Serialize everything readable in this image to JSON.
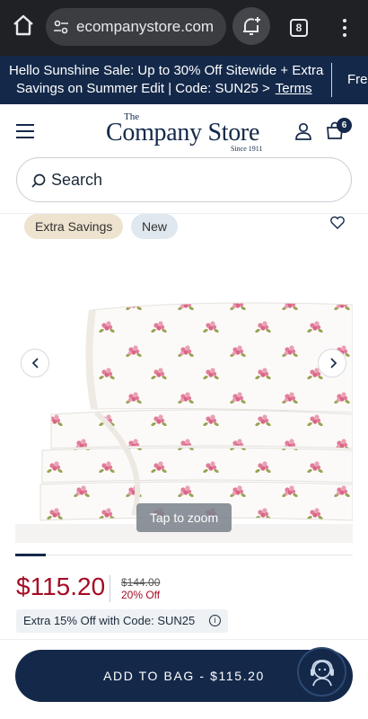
{
  "browser": {
    "url": "ecompanystore.com",
    "tab_count": "8",
    "icons": [
      "home-icon",
      "site-settings-icon",
      "add-notification-icon",
      "tab-switcher-icon",
      "more-options-icon"
    ]
  },
  "promo_banner": {
    "line1": "Hello Sunshine Sale: Up to 30% Off Sitewide + Extra",
    "line2": "Savings on Summer Edit | Code: SUN25 >",
    "terms_link": "Terms",
    "next_teaser": "Fre"
  },
  "header": {
    "logo_the": "The",
    "logo_name": "Company Store",
    "logo_since": "Since 1911",
    "bag_count": "6"
  },
  "search": {
    "placeholder": "Search"
  },
  "product": {
    "badges": [
      "Extra Savings",
      "New"
    ],
    "zoom_hint": "Tap to zoom",
    "gallery_progress": 0.09,
    "price": "$115.20",
    "original_price": "$144.00",
    "percent_off": "20% Off",
    "promo_text": "Extra 15% Off with Code: SUN25",
    "info_glyph": "i"
  },
  "cta": {
    "add_to_bag": "ADD TO BAG - $115.20"
  },
  "colors": {
    "navy": "#14294a",
    "sale_red": "#a50c24",
    "badge_extra_bg": "#ede3cf",
    "badge_new_bg": "#dfe7ef",
    "flower_pink": "#e37b98",
    "leaf_green": "#9aa253"
  }
}
